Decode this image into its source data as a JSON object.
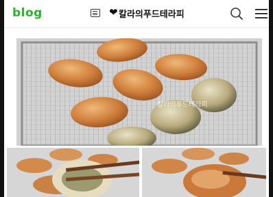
{
  "header": {
    "logo": "blog",
    "blog_title": "칼라의푸드테라피",
    "heart_glyph": "❤"
  },
  "icons": {
    "list": "list-icon",
    "search": "search-icon",
    "menu": "hamburger-menu-icon"
  },
  "colors": {
    "logo_green": "#28b42c"
  },
  "photos": {
    "main_watermark": "칼라의푸드테라피"
  }
}
